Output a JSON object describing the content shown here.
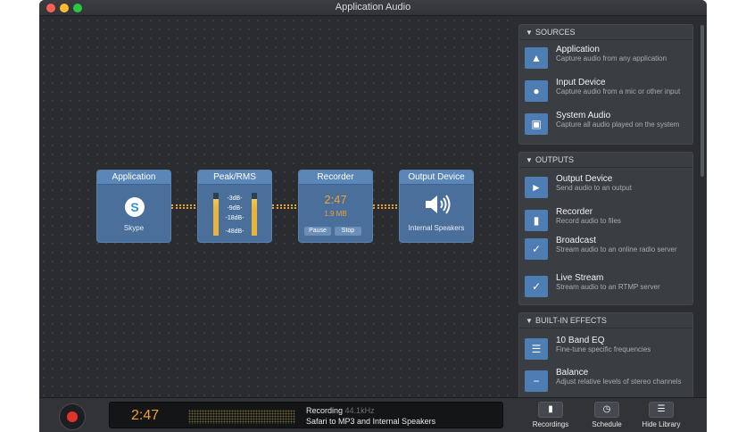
{
  "window": {
    "title": "Application Audio"
  },
  "pipeline": {
    "application": {
      "header": "Application",
      "label": "Skype"
    },
    "peak_rms": {
      "header": "Peak/RMS",
      "levels": [
        "-3dB-",
        "-9dB-",
        "-18dB-",
        "-48dB-"
      ],
      "left_meter": 0.85,
      "right_meter": 0.85
    },
    "recorder": {
      "header": "Recorder",
      "time": "2:47",
      "size": "1.9 MB",
      "pause_label": "Pause",
      "stop_label": "Stop"
    },
    "output_device": {
      "header": "Output Device",
      "label": "Internal Speakers"
    }
  },
  "sources": {
    "header": "SOURCES",
    "items": [
      {
        "title": "Application",
        "desc": "Capture audio from any application",
        "icon": "application-icon"
      },
      {
        "title": "Input Device",
        "desc": "Capture audio from a mic or other input",
        "icon": "microphone-icon"
      },
      {
        "title": "System Audio",
        "desc": "Capture all audio played on the system",
        "icon": "monitor-icon"
      }
    ]
  },
  "outputs": {
    "header": "OUTPUTS",
    "items": [
      {
        "title": "Output Device",
        "desc": "Send audio to an output",
        "icon": "speaker-icon"
      },
      {
        "title": "Recorder",
        "desc": "Record audio to files",
        "icon": "file-icon"
      },
      {
        "title": "Broadcast",
        "desc": "Stream audio to an online radio server",
        "icon": "broadcast-icon"
      },
      {
        "title": "Live Stream",
        "desc": "Stream audio to an RTMP server",
        "icon": "live-stream-icon"
      }
    ]
  },
  "effects": {
    "header": "BUILT-IN EFFECTS",
    "items": [
      {
        "title": "10 Band EQ",
        "desc": "Fine-tune specific frequencies",
        "icon": "equalizer-icon"
      },
      {
        "title": "Balance",
        "desc": "Adjust relative levels of stereo channels",
        "icon": "balance-icon"
      }
    ]
  },
  "status": {
    "time": "2:47",
    "state": "Recording",
    "rate": "44.1kHz",
    "detail": "Safari to MP3 and Internal Speakers"
  },
  "toolbar": {
    "recordings": "Recordings",
    "schedule": "Schedule",
    "hide_library": "Hide Library"
  },
  "colors": {
    "accent": "#f0a030",
    "node": "#4a6f9b",
    "record": "#e2332b"
  }
}
